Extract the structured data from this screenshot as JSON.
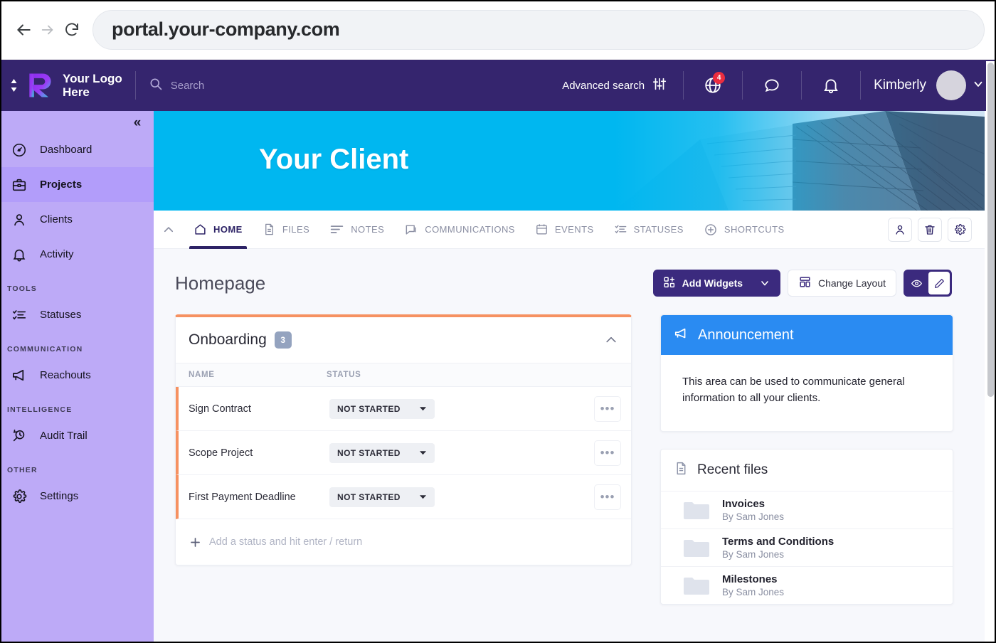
{
  "browser": {
    "url": "portal.your-company.com",
    "back_label": "Back",
    "forward_label": "Forward",
    "reload_label": "Reload"
  },
  "header": {
    "logo_text": "Your Logo\nHere",
    "search_placeholder": "Search",
    "advanced_search_label": "Advanced search",
    "globe_badge": "4",
    "user_name": "Kimberly"
  },
  "sidebar": {
    "items": [
      {
        "label": "Dashboard",
        "icon": "speedometer-icon",
        "active": false
      },
      {
        "label": "Projects",
        "icon": "briefcase-icon",
        "active": true
      },
      {
        "label": "Clients",
        "icon": "person-icon",
        "active": false
      },
      {
        "label": "Activity",
        "icon": "bell-icon",
        "active": false
      }
    ],
    "groups": [
      {
        "label": "TOOLS",
        "items": [
          {
            "label": "Statuses",
            "icon": "list-checks-icon"
          }
        ]
      },
      {
        "label": "COMMUNICATION",
        "items": [
          {
            "label": "Reachouts",
            "icon": "megaphone-icon"
          }
        ]
      },
      {
        "label": "INTELLIGENCE",
        "items": [
          {
            "label": "Audit Trail",
            "icon": "history-search-icon"
          }
        ]
      },
      {
        "label": "OTHER",
        "items": [
          {
            "label": "Settings",
            "icon": "gear-icon"
          }
        ]
      }
    ]
  },
  "hero": {
    "title": "Your Client"
  },
  "tabs": [
    {
      "label": "HOME",
      "icon": "home-icon",
      "active": true
    },
    {
      "label": "FILES",
      "icon": "document-icon",
      "active": false
    },
    {
      "label": "NOTES",
      "icon": "lines-icon",
      "active": false
    },
    {
      "label": "COMMUNICATIONS",
      "icon": "chat-icon",
      "active": false
    },
    {
      "label": "EVENTS",
      "icon": "calendar-icon",
      "active": false
    },
    {
      "label": "STATUSES",
      "icon": "list-checks-icon",
      "active": false
    },
    {
      "label": "SHORTCUTS",
      "icon": "plus-circle-icon",
      "active": false
    }
  ],
  "tab_actions": [
    {
      "name": "person-icon"
    },
    {
      "name": "trash-icon"
    },
    {
      "name": "gear-icon"
    }
  ],
  "main": {
    "page_title": "Homepage",
    "add_widgets_label": "Add Widgets",
    "change_layout_label": "Change Layout",
    "view_mode_label": "Preview",
    "edit_mode_label": "Edit"
  },
  "onboarding": {
    "title": "Onboarding",
    "count": "3",
    "columns": {
      "name": "NAME",
      "status": "STATUS"
    },
    "rows": [
      {
        "name": "Sign Contract",
        "status": "NOT STARTED"
      },
      {
        "name": "Scope Project",
        "status": "NOT STARTED"
      },
      {
        "name": "First Payment Deadline",
        "status": "NOT STARTED"
      }
    ],
    "add_placeholder": "Add a status and hit enter / return",
    "more_label": "•••"
  },
  "announcement": {
    "title": "Announcement",
    "body": "This area can be used to communicate general information to all your clients."
  },
  "recent_files": {
    "title": "Recent files",
    "items": [
      {
        "name": "Invoices",
        "by": "By Sam Jones"
      },
      {
        "name": "Terms and Conditions",
        "by": "By Sam Jones"
      },
      {
        "name": "Milestones",
        "by": "By Sam Jones"
      }
    ]
  },
  "colors": {
    "header_purple": "#35256e",
    "sidebar_purple": "#bdaaf7",
    "sidebar_active": "#b29dfa",
    "hero_cyan": "#00b7f0",
    "accent_dark": "#3b2a7e",
    "announcement_blue": "#2a8bf2",
    "onboarding_orange": "#f69161",
    "badge_red": "#ec2d3f",
    "badge_grey_blue": "#94a3bf"
  }
}
